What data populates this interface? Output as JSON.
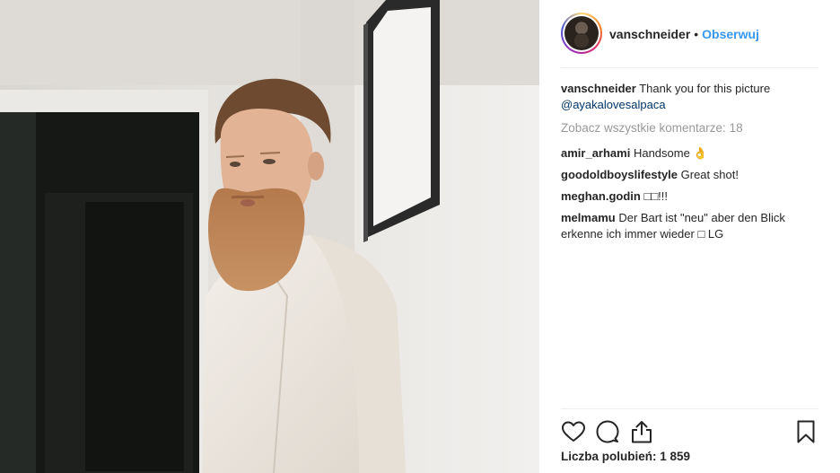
{
  "post": {
    "username": "vanschneider",
    "dot": "•",
    "follow_label": "Obserwuj"
  },
  "caption": {
    "user": "vanschneider",
    "text": "Thank you for this picture",
    "mention": "@ayakalovesalpaca"
  },
  "view_all_comments": "Zobacz wszystkie komentarze: 18",
  "comments": [
    {
      "user": "amir_arhami",
      "text": "Handsome 👌"
    },
    {
      "user": "goodoldboyslifestyle",
      "text": "Great shot!"
    },
    {
      "user": "meghan.godin",
      "text": "□□!!!"
    },
    {
      "user": "melmamu",
      "text": "Der Bart ist \"neu\" aber den Blick erkenne ich immer wieder □ LG"
    }
  ],
  "likes_text": "Liczba polubień: 1 859",
  "icons": {
    "like": "heart-icon",
    "comment": "comment-icon",
    "share": "share-icon",
    "save": "bookmark-icon"
  },
  "colors": {
    "link_blue": "#3897f0",
    "mention_blue": "#003569",
    "muted": "#999999",
    "text": "#262626"
  }
}
